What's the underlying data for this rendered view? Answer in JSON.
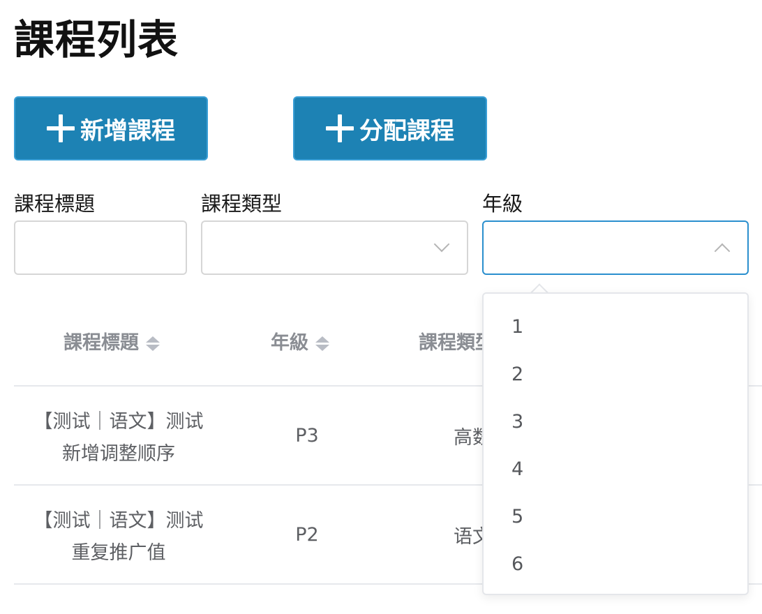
{
  "page": {
    "title": "課程列表"
  },
  "toolbar": {
    "add_label": "新增課程",
    "assign_label": "分配課程"
  },
  "filters": {
    "title_label": "課程標題",
    "type_label": "課程類型",
    "grade_label": "年級"
  },
  "table": {
    "columns": [
      "課程標題",
      "年級",
      "課程類型"
    ],
    "rows": [
      {
        "title_line1": "【测试｜语文】测试",
        "title_line2": "新增调整顺序",
        "grade": "P3",
        "type": "高数"
      },
      {
        "title_line1": "【测试｜语文】测试",
        "title_line2": "重复推广值",
        "grade": "P2",
        "type": "语文"
      }
    ]
  },
  "grade_dropdown": {
    "options": [
      "1",
      "2",
      "3",
      "4",
      "5",
      "6"
    ]
  },
  "colors": {
    "primary_button": "#1d82b4",
    "focus_border": "#2a8fce"
  },
  "icons": [
    "plus-icon",
    "chevron-down-icon",
    "chevron-up-icon",
    "sort-icon"
  ]
}
